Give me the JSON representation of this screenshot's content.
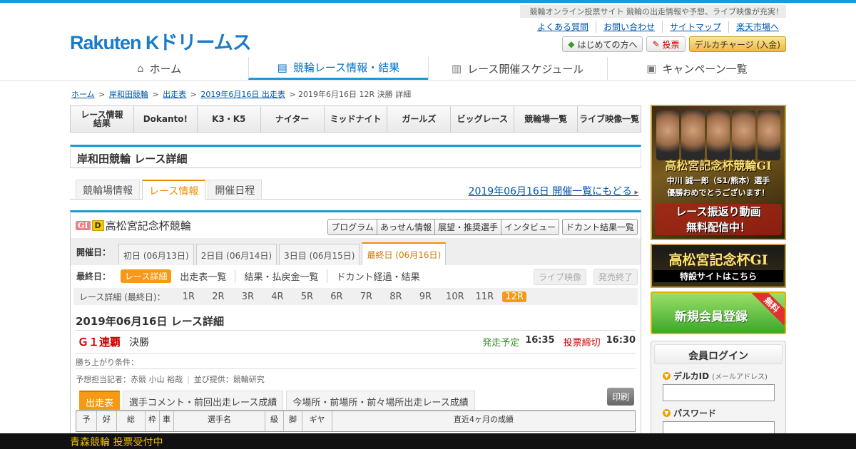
{
  "header": {
    "tagline": "競輪オンライン投票サイト 競輪の出走情報や予想、ライブ映像が充実！",
    "logo": "Rakuten Kドリームス",
    "links": [
      "よくある質問",
      "お問い合わせ",
      "サイトマップ",
      "楽天市場へ"
    ],
    "buttons": {
      "beginner": "はじめての方へ",
      "vote": "投票",
      "charge": "デルカチャージ (入金)"
    }
  },
  "gnav": [
    "ホーム",
    "競輪レース情報・結果",
    "レース開催スケジュール",
    "キャンペーン一覧"
  ],
  "breadcrumb": {
    "home": "ホーム",
    "track": "岸和田競輪",
    "program": "出走表",
    "date_program": "2019年6月16日 出走表",
    "current": "2019年6月16日 12R 決勝 詳細"
  },
  "subnav": [
    "レース情報\n結果",
    "Dokanto!",
    "K3・K5",
    "ナイター",
    "ミッドナイト",
    "ガールズ",
    "ビッグレース",
    "競輪場一覧",
    "ライブ映像一覧"
  ],
  "page_title": "岸和田競輪 レース詳細",
  "tabs": [
    "競輪場情報",
    "レース情報",
    "開催日程"
  ],
  "back_link": "2019年06月16日 開催一覧にもどる",
  "race": {
    "grade_icon": "GI",
    "d_icon": "D",
    "name": "高松宮記念杯競輪",
    "buttons": [
      "プログラム",
      "あっせん情報",
      "展望・推奨選手",
      "インタビュー"
    ],
    "dokanto_btn": "ドカント結果一覧",
    "days_label": "開催日：",
    "days": [
      "初日 (06月13日)",
      "2日目 (06月14日)",
      "3日目 (06月15日)",
      "最終日 (06月16日)"
    ],
    "final_label": "最終日：",
    "final_items": [
      "レース詳細",
      "出走表一覧",
      "結果・払戻金一覧",
      "ドカント経過・結果"
    ],
    "live_btn": "ライブ映像",
    "closed_btn": "発売終了",
    "rnum_label": "レース詳細 (最終日)：",
    "rnums": [
      "1R",
      "2R",
      "3R",
      "4R",
      "5R",
      "6R",
      "7R",
      "8R",
      "9R",
      "10R",
      "11R",
      "12R"
    ],
    "detail_title": "2019年06月16日 レース詳細",
    "grade": "Ｇ１連覇",
    "race_name": "決勝",
    "start_label": "発走予定",
    "start_time": "16:35",
    "close_label": "投票締切",
    "close_time": "16:30",
    "condition": "勝ち上がり条件：",
    "predictor": "予想担当記者：赤競 小山 裕哉",
    "lineup": "並び提供：競輪研究",
    "entry_tabs": [
      "出走表",
      "選手コメント・前回出走レース成績",
      "今場所・前場所・前々場所出走レース成績"
    ],
    "print": "印刷",
    "columns": [
      "予",
      "好",
      "総",
      "枠",
      "車",
      "選手名",
      "級",
      "脚",
      "ギヤ",
      "直近4ヶ月の成績"
    ]
  },
  "sidebar": {
    "banner1_title": "高松宮記念杯競輪GI",
    "banner1_msg1": "中川 誠一郎（S1/熊本）選手",
    "banner1_msg2": "優勝おめでとうございます！",
    "banner1_cta1": "レース振返り動画",
    "banner1_cta2": "無料配信中！",
    "banner2_title": "高松宮記念杯GI",
    "banner2_sub": "特設サイトはこちら",
    "banner3": "新規会員登録",
    "banner3_free": "無料",
    "login_title": "会員ログイン",
    "id_label": "デルカID",
    "id_hint": "(メールアドレス)",
    "pw_label": "パスワード"
  },
  "ticker": "青森競輪 投票受付中",
  "colors": {
    "accent": "#1a9ad6",
    "orange": "#f59a12",
    "red": "#cc0000"
  }
}
